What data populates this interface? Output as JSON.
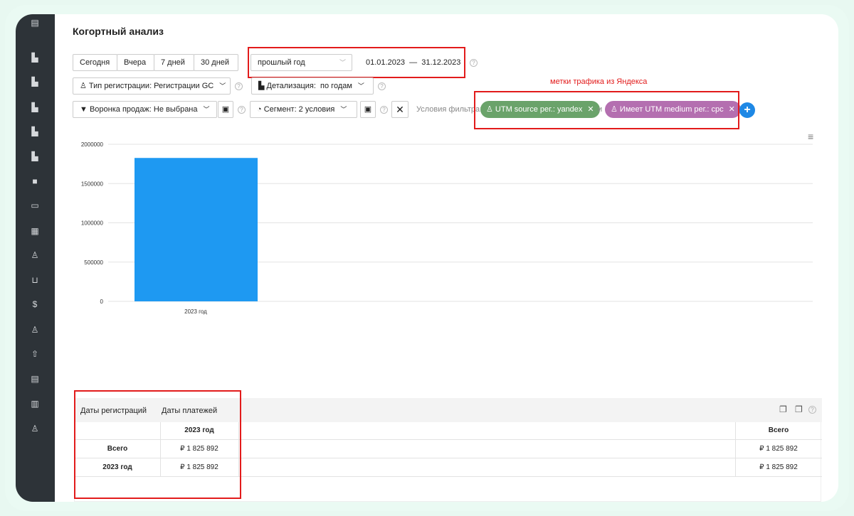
{
  "page": {
    "title": "Когортный анализ"
  },
  "quick_ranges": [
    "Сегодня",
    "Вчера",
    "7 дней",
    "30 дней"
  ],
  "period": {
    "select": "прошлый год",
    "range": "01.01.2023  —  31.12.2023"
  },
  "filters": {
    "reg_type": "Тип регистрации: Регистрации GC",
    "detail": "Детализация:  по годам",
    "funnel": "Воронка продаж: Не выбрана",
    "segment": "Сегмент: 2 условия",
    "conditions_label": "Условия фильтра:",
    "joiner": "и",
    "chips": [
      {
        "label": "UTM source рег.: yandex",
        "color": "#6aa36a"
      },
      {
        "label": "Имеет UTM medium рег.: cpc",
        "color": "#b46fb0"
      }
    ]
  },
  "annotation": "метки трафика из Яндекса",
  "chart_data": {
    "type": "bar",
    "categories": [
      "2023 год"
    ],
    "values": [
      1825892
    ],
    "ylim": [
      0,
      2000000
    ],
    "yticks": [
      "0",
      "500000",
      "1000000",
      "1500000",
      "2000000"
    ],
    "grid": true,
    "colors": [
      "#1e99f2"
    ]
  },
  "table": {
    "head_left": "Даты регистраций",
    "head_right": "Даты платежей",
    "col_year": "2023 год",
    "col_total": "Всего",
    "rows": [
      {
        "label": "Всего",
        "value": "₽ 1 825 892",
        "total": "₽ 1 825 892"
      },
      {
        "label": "2023 год",
        "value": "₽ 1 825 892",
        "total": "₽ 1 825 892"
      }
    ]
  }
}
